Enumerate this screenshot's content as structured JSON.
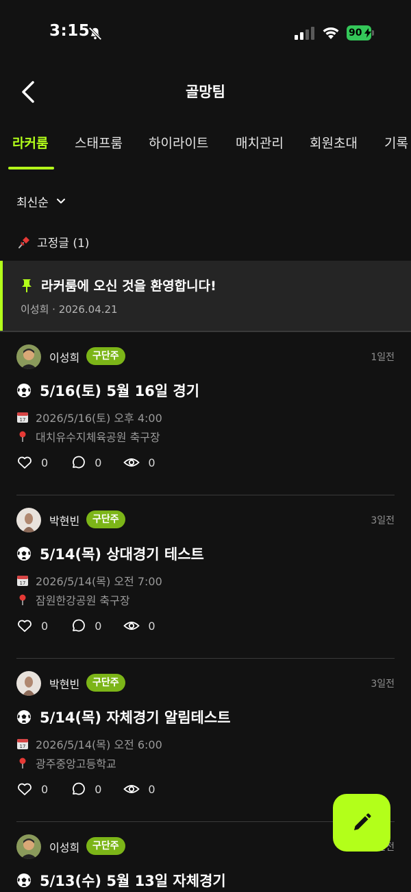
{
  "status_bar": {
    "time": "3:15",
    "battery": "90"
  },
  "header": {
    "title": "골망팀",
    "back_icon": "chevron-left-icon"
  },
  "tabs": [
    {
      "label": "라커룸",
      "active": true
    },
    {
      "label": "스태프룸",
      "active": false
    },
    {
      "label": "하이라이트",
      "active": false
    },
    {
      "label": "매치관리",
      "active": false
    },
    {
      "label": "회원초대",
      "active": false
    },
    {
      "label": "기록",
      "active": false
    }
  ],
  "sort": {
    "label": "최신순"
  },
  "pinned": {
    "header": "고정글 (1)",
    "post": {
      "title": "라커룸에 오신 것을 환영합니다!",
      "meta": "이성희 · 2026.04.21"
    }
  },
  "posts": [
    {
      "author": "이성희",
      "badge": "구단주",
      "time_ago": "1일전",
      "title": "5/16(토) 5월 16일 경기",
      "date": "2026/5/16(토) 오후 4:00",
      "location": "대치유수지체육공원 축구장",
      "likes": "0",
      "comments": "0",
      "views": "0"
    },
    {
      "author": "박현빈",
      "badge": "구단주",
      "time_ago": "3일전",
      "title": "5/14(목) 상대경기 테스트",
      "date": "2026/5/14(목) 오전 7:00",
      "location": "잠원한강공원 축구장",
      "likes": "0",
      "comments": "0",
      "views": "0"
    },
    {
      "author": "박현빈",
      "badge": "구단주",
      "time_ago": "3일전",
      "title": "5/14(목) 자체경기 알림테스트",
      "date": "2026/5/14(목) 오전 6:00",
      "location": "광주중앙고등학교",
      "likes": "0",
      "comments": "0",
      "views": "0"
    },
    {
      "author": "이성희",
      "badge": "구단주",
      "time_ago": "3일전",
      "title": "5/13(수) 5월 13일 자체경기"
    }
  ],
  "colors": {
    "accent": "#b3ff1a",
    "badge": "#7cb518",
    "background": "#121212",
    "pinned_bg": "#252525"
  },
  "fab": {
    "icon": "pencil-icon"
  }
}
